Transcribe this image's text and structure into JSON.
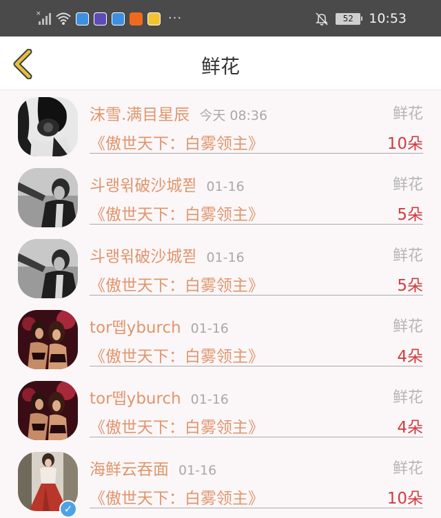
{
  "status_bar": {
    "battery": "52",
    "time": "10:53"
  },
  "header": {
    "title": "鲜花"
  },
  "records": [
    {
      "user": "沫雪.满目星辰",
      "time": "今天 08:36",
      "gift": "鲜花",
      "book": "《傲世天下：白雾领主》",
      "count": "10朵",
      "avatar": "avatar-woman-camera",
      "verified": false
    },
    {
      "user": "斗랭윆破沙城쬗",
      "time": "01-16",
      "gift": "鲜花",
      "book": "《傲世天下：白雾领主》",
      "count": "5朵",
      "avatar": "avatar-bw-man",
      "verified": false
    },
    {
      "user": "斗랭윆破沙城쬗",
      "time": "01-16",
      "gift": "鲜花",
      "book": "《傲世天下：白雾领主》",
      "count": "5朵",
      "avatar": "avatar-bw-man",
      "verified": false
    },
    {
      "user": "tor뗍yburch",
      "time": "01-16",
      "gift": "鲜花",
      "book": "《傲世天下：白雾领主》",
      "count": "4朵",
      "avatar": "avatar-girls-party",
      "verified": false
    },
    {
      "user": "tor뗍yburch",
      "time": "01-16",
      "gift": "鲜花",
      "book": "《傲世天下：白雾领主》",
      "count": "4朵",
      "avatar": "avatar-girls-party",
      "verified": false
    },
    {
      "user": "海鲜云吞面",
      "time": "01-16",
      "gift": "鲜花",
      "book": "《傲世天下：白雾领主》",
      "count": "10朵",
      "avatar": "avatar-red-skirt",
      "verified": true
    }
  ],
  "colors": {
    "username": "#e0956c",
    "count": "#d33a3f",
    "status_bar": "#4a4a4a",
    "back_arrow": "#d9b43a"
  }
}
